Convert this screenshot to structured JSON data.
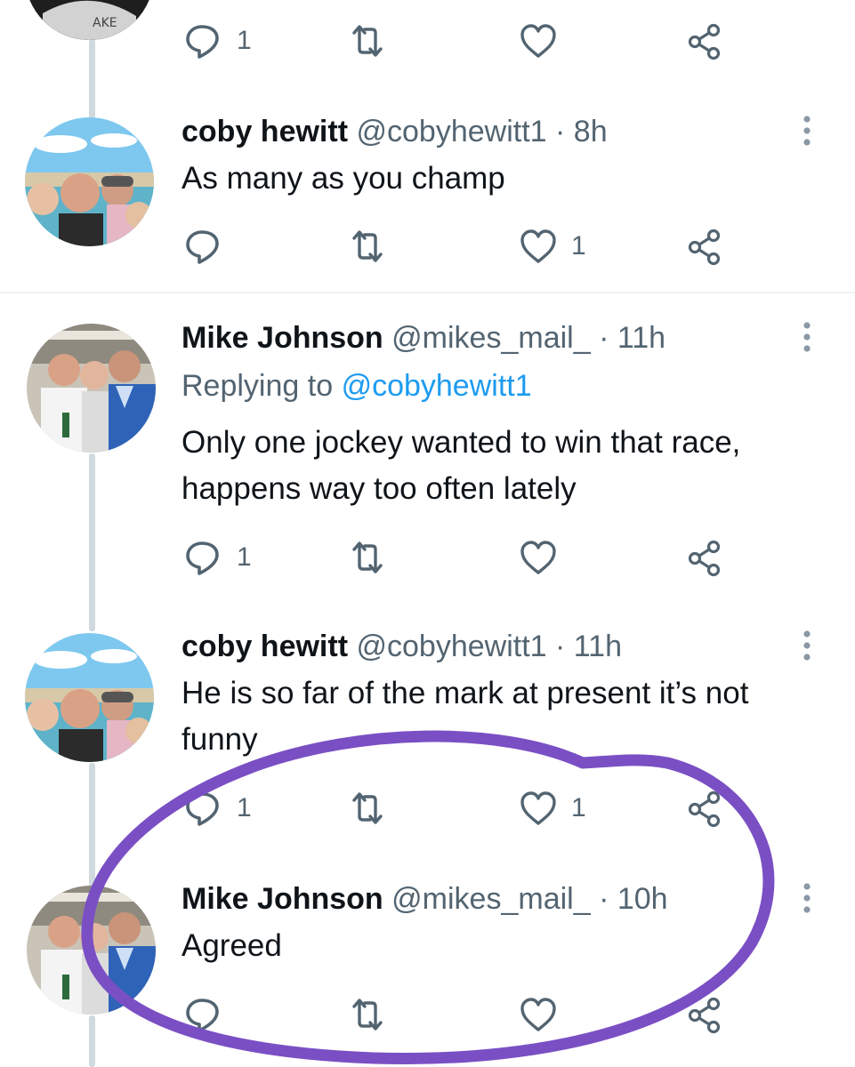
{
  "top_tweet_actions": {
    "reply_count": "1",
    "retweet_count": "",
    "like_count": ""
  },
  "tweets": [
    {
      "name": "coby hewitt",
      "handle": "@cobyhewitt1",
      "separator": "·",
      "time": "8h",
      "text": "As many as you champ",
      "reply_count": "",
      "retweet_count": "",
      "like_count": "1"
    },
    {
      "name": "Mike Johnson",
      "handle": "@mikes_mail_",
      "separator": "·",
      "time": "11h",
      "replying_prefix": "Replying to",
      "replying_mention": "@cobyhewitt1",
      "text": "Only one jockey wanted to win that race, happens way too often lately",
      "reply_count": "1",
      "retweet_count": "",
      "like_count": ""
    },
    {
      "name": "coby hewitt",
      "handle": "@cobyhewitt1",
      "separator": "·",
      "time": "11h",
      "text": "He is so far of the mark at present it’s not funny",
      "reply_count": "1",
      "retweet_count": "",
      "like_count": "1"
    },
    {
      "name": "Mike Johnson",
      "handle": "@mikes_mail_",
      "separator": "·",
      "time": "10h",
      "text": "Agreed",
      "reply_count": "",
      "retweet_count": "",
      "like_count": ""
    }
  ],
  "colors": {
    "text_primary": "#0f1419",
    "text_secondary": "#536471",
    "link": "#1d9bf0",
    "thread_line": "#cfd9de",
    "annotation": "#7a4fc4"
  },
  "icons": [
    "reply-icon",
    "retweet-icon",
    "like-icon",
    "share-icon",
    "more-icon"
  ]
}
